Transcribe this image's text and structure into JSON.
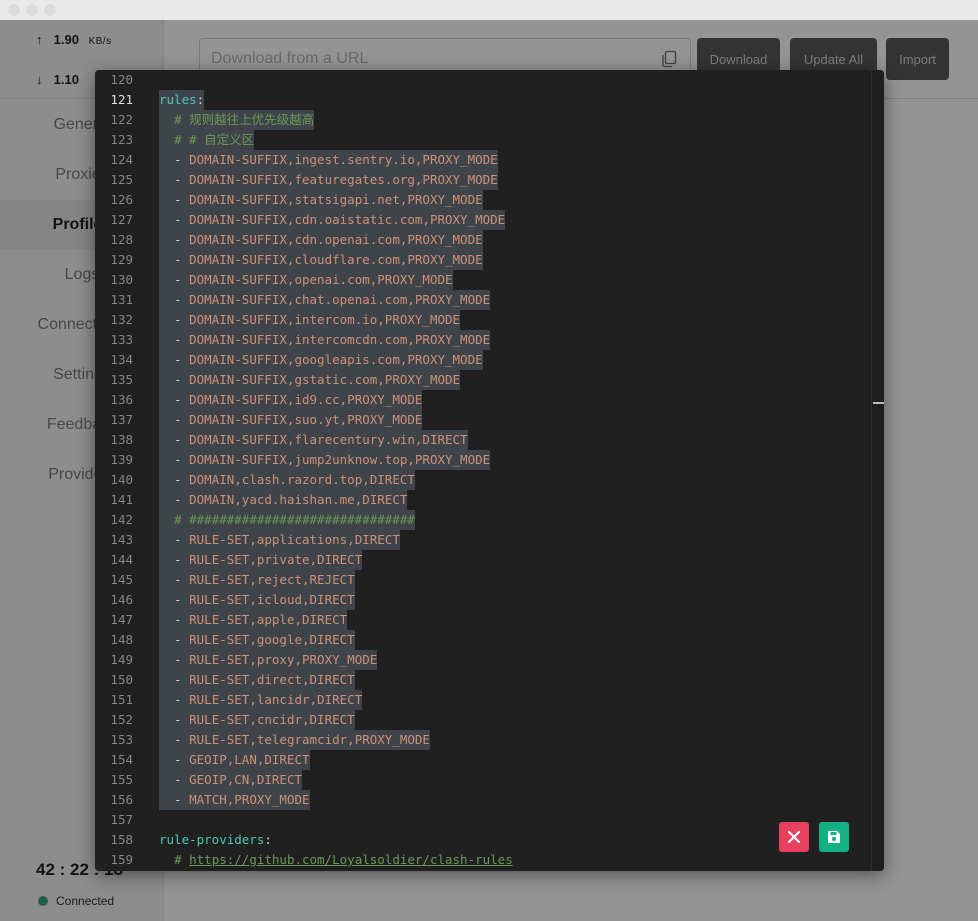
{
  "sidebar": {
    "upload": {
      "arrow": "↑",
      "value": "1.90",
      "unit": "KB/s"
    },
    "download": {
      "arrow": "↓",
      "value": "1.10"
    },
    "nav": [
      {
        "label": "General",
        "active": false
      },
      {
        "label": "Proxies",
        "active": false
      },
      {
        "label": "Profiles",
        "active": true
      },
      {
        "label": "Logs",
        "active": false
      },
      {
        "label": "Connections",
        "active": false
      },
      {
        "label": "Settings",
        "active": false
      },
      {
        "label": "Feedback",
        "active": false
      },
      {
        "label": "Providers",
        "active": false
      }
    ],
    "clock": "42 : 22 : 18",
    "status": "Connected"
  },
  "header": {
    "url_placeholder": "Download from a URL",
    "buttons": {
      "download": "Download",
      "update_all": "Update All",
      "import": "Import"
    }
  },
  "editor": {
    "current_line": 121,
    "lines": [
      {
        "n": 120,
        "t": "",
        "sel": false
      },
      {
        "n": 121,
        "t": "rules:",
        "sel": true
      },
      {
        "n": 122,
        "t": "  # 规则越往上优先级越高",
        "sel": true
      },
      {
        "n": 123,
        "t": "  # # 自定义区",
        "sel": true
      },
      {
        "n": 124,
        "t": "  - DOMAIN-SUFFIX,ingest.sentry.io,PROXY_MODE",
        "sel": true
      },
      {
        "n": 125,
        "t": "  - DOMAIN-SUFFIX,featuregates.org,PROXY_MODE",
        "sel": true
      },
      {
        "n": 126,
        "t": "  - DOMAIN-SUFFIX,statsigapi.net,PROXY_MODE",
        "sel": true
      },
      {
        "n": 127,
        "t": "  - DOMAIN-SUFFIX,cdn.oaistatic.com,PROXY_MODE",
        "sel": true
      },
      {
        "n": 128,
        "t": "  - DOMAIN-SUFFIX,cdn.openai.com,PROXY_MODE",
        "sel": true
      },
      {
        "n": 129,
        "t": "  - DOMAIN-SUFFIX,cloudflare.com,PROXY_MODE",
        "sel": true
      },
      {
        "n": 130,
        "t": "  - DOMAIN-SUFFIX,openai.com,PROXY_MODE",
        "sel": true
      },
      {
        "n": 131,
        "t": "  - DOMAIN-SUFFIX,chat.openai.com,PROXY_MODE",
        "sel": true
      },
      {
        "n": 132,
        "t": "  - DOMAIN-SUFFIX,intercom.io,PROXY_MODE",
        "sel": true
      },
      {
        "n": 133,
        "t": "  - DOMAIN-SUFFIX,intercomcdn.com,PROXY_MODE",
        "sel": true
      },
      {
        "n": 134,
        "t": "  - DOMAIN-SUFFIX,googleapis.com,PROXY_MODE",
        "sel": true
      },
      {
        "n": 135,
        "t": "  - DOMAIN-SUFFIX,gstatic.com,PROXY_MODE",
        "sel": true
      },
      {
        "n": 136,
        "t": "  - DOMAIN-SUFFIX,id9.cc,PROXY_MODE",
        "sel": true
      },
      {
        "n": 137,
        "t": "  - DOMAIN-SUFFIX,suo.yt,PROXY_MODE",
        "sel": true
      },
      {
        "n": 138,
        "t": "  - DOMAIN-SUFFIX,flarecentury.win,DIRECT",
        "sel": true
      },
      {
        "n": 139,
        "t": "  - DOMAIN-SUFFIX,jump2unknow.top,PROXY_MODE",
        "sel": true
      },
      {
        "n": 140,
        "t": "  - DOMAIN,clash.razord.top,DIRECT",
        "sel": true
      },
      {
        "n": 141,
        "t": "  - DOMAIN,yacd.haishan.me,DIRECT",
        "sel": true
      },
      {
        "n": 142,
        "t": "  # ##############################",
        "sel": true
      },
      {
        "n": 143,
        "t": "  - RULE-SET,applications,DIRECT",
        "sel": true
      },
      {
        "n": 144,
        "t": "  - RULE-SET,private,DIRECT",
        "sel": true
      },
      {
        "n": 145,
        "t": "  - RULE-SET,reject,REJECT",
        "sel": true
      },
      {
        "n": 146,
        "t": "  - RULE-SET,icloud,DIRECT",
        "sel": true
      },
      {
        "n": 147,
        "t": "  - RULE-SET,apple,DIRECT",
        "sel": true
      },
      {
        "n": 148,
        "t": "  - RULE-SET,google,DIRECT",
        "sel": true
      },
      {
        "n": 149,
        "t": "  - RULE-SET,proxy,PROXY_MODE",
        "sel": true
      },
      {
        "n": 150,
        "t": "  - RULE-SET,direct,DIRECT",
        "sel": true
      },
      {
        "n": 151,
        "t": "  - RULE-SET,lancidr,DIRECT",
        "sel": true
      },
      {
        "n": 152,
        "t": "  - RULE-SET,cncidr,DIRECT",
        "sel": true
      },
      {
        "n": 153,
        "t": "  - RULE-SET,telegramcidr,PROXY_MODE",
        "sel": true
      },
      {
        "n": 154,
        "t": "  - GEOIP,LAN,DIRECT",
        "sel": true
      },
      {
        "n": 155,
        "t": "  - GEOIP,CN,DIRECT",
        "sel": true
      },
      {
        "n": 156,
        "t": "  - MATCH,PROXY_MODE",
        "sel": true
      },
      {
        "n": 157,
        "t": "",
        "sel": false
      },
      {
        "n": 158,
        "t": "rule-providers:",
        "sel": false
      },
      {
        "n": 159,
        "t": "  # https://github.com/Loyalsoldier/clash-rules",
        "sel": false
      }
    ]
  },
  "actions": {
    "cancel_icon": "close-icon",
    "save_icon": "save-icon"
  },
  "colors": {
    "editor_bg": "#202020",
    "selection": "#3f434a",
    "yaml_key": "#4ec9b0",
    "string": "#ce9178",
    "comment": "#6a9955",
    "cancel": "#e8405f",
    "save": "#13b084",
    "status_ok": "#3aa57a"
  }
}
